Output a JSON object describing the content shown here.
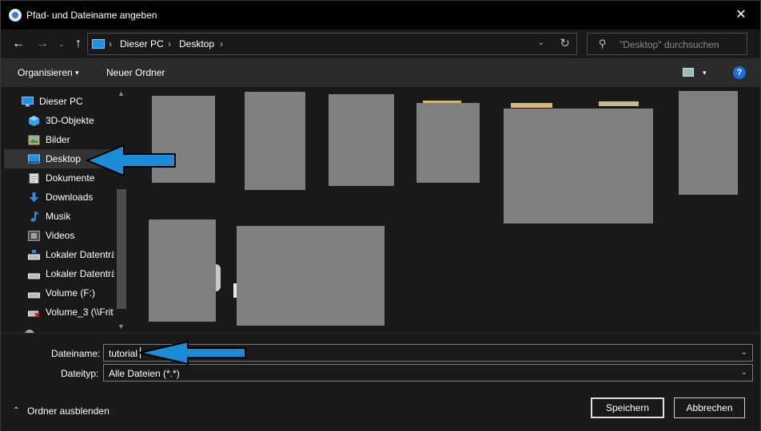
{
  "window": {
    "title": "Pfad- und Dateiname angeben",
    "close_glyph": "✕"
  },
  "nav": {
    "back_glyph": "←",
    "forward_glyph": "→",
    "dropdown_glyph": "⌄",
    "up_glyph": "↑",
    "breadcrumb": [
      {
        "label": "Dieser PC"
      },
      {
        "label": "Desktop"
      }
    ],
    "separator_glyph": "›",
    "addr_chevron_glyph": "⌄",
    "refresh_glyph": "↻",
    "search_placeholder": "\"Desktop\" durchsuchen",
    "search_glyph": "⚲"
  },
  "toolbar": {
    "organize_label": "Organisieren",
    "organize_chevron": "▾",
    "new_folder_label": "Neuer Ordner",
    "view_chevron": "▾",
    "help_label": "?"
  },
  "sidebar": {
    "up_glyph": "▲",
    "down_glyph": "▼",
    "items": [
      {
        "label": "Dieser PC",
        "icon": "computer-icon",
        "color": "#1e90e6"
      },
      {
        "label": "3D-Objekte",
        "icon": "cube-icon",
        "color": "#3aa0e8"
      },
      {
        "label": "Bilder",
        "icon": "pictures-icon",
        "color": "#c9a85a"
      },
      {
        "label": "Desktop",
        "icon": "desktop-icon",
        "color": "#1e90e6",
        "selected": true
      },
      {
        "label": "Dokumente",
        "icon": "documents-icon",
        "color": "#d8d8d8"
      },
      {
        "label": "Downloads",
        "icon": "download-icon",
        "color": "#2a8be0"
      },
      {
        "label": "Musik",
        "icon": "music-icon",
        "color": "#2a8be0"
      },
      {
        "label": "Videos",
        "icon": "videos-icon",
        "color": "#a0a0a0"
      },
      {
        "label": "Lokaler Datenträ",
        "icon": "drive-icon",
        "color": "#bbbbbb"
      },
      {
        "label": "Lokaler Datenträ",
        "icon": "drive-icon",
        "color": "#bbbbbb"
      },
      {
        "label": "Volume (F:)",
        "icon": "drive-icon",
        "color": "#bbbbbb"
      },
      {
        "label": "Volume_3 (\\\\Frit",
        "icon": "network-drive-disconnected-icon",
        "color": "#d02020"
      }
    ]
  },
  "form": {
    "filename_label": "Dateiname:",
    "filename_value": "tutorial",
    "filetype_label": "Dateityp:",
    "filetype_value": "Alle Dateien (*.*)",
    "chevron_glyph": "⌄",
    "save_label": "Speichern",
    "cancel_label": "Abbrechen",
    "hide_folders_label": "Ordner ausblenden",
    "hide_chevron": "⌃"
  },
  "colors": {
    "accent": "#1e90e6",
    "annotation_arrow": "#1a8cd8",
    "redaction": "#808080"
  }
}
